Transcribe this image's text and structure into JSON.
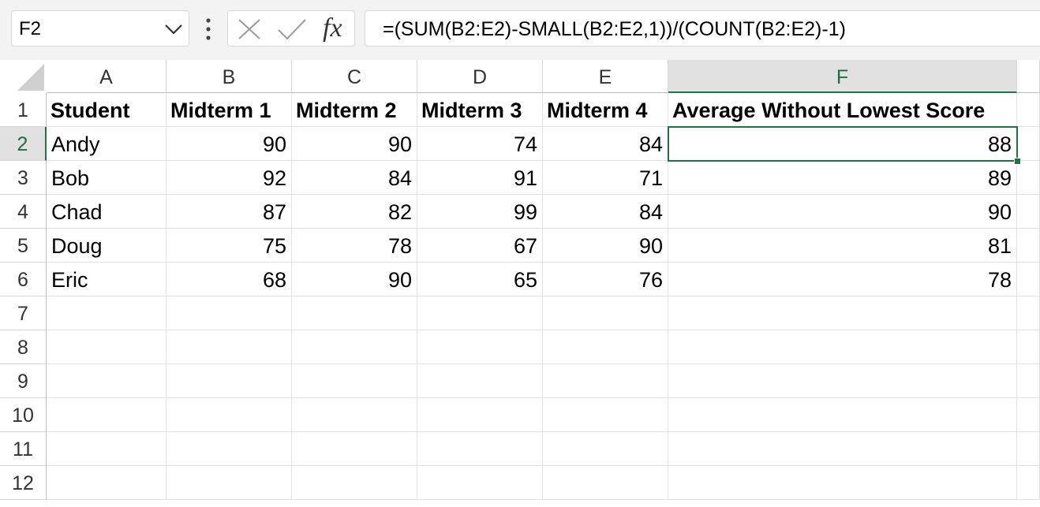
{
  "name_box": {
    "value": "F2"
  },
  "formula_bar": {
    "fx_label": "fx",
    "formula": "=(SUM(B2:E2)-SMALL(B2:E2,1))/(COUNT(B2:E2)-1)"
  },
  "icons": {
    "name_box_dropdown": "chevron-down-icon",
    "more": "vertical-dots-icon",
    "cancel": "x-icon",
    "enter": "checkmark-icon",
    "insert_function": "fx-icon"
  },
  "colors": {
    "selection_accent": "#217346",
    "header_selected_bg": "#e1e1e1"
  },
  "sheet": {
    "columns": [
      "A",
      "B",
      "C",
      "D",
      "E",
      "F"
    ],
    "rows": [
      "1",
      "2",
      "3",
      "4",
      "5",
      "6",
      "7",
      "8",
      "9",
      "10",
      "11",
      "12"
    ],
    "active_cell": "F2",
    "header_row": [
      "Student",
      "Midterm 1",
      "Midterm 2",
      "Midterm 3",
      "Midterm 4",
      "Average Without Lowest Score"
    ],
    "data": [
      [
        "Andy",
        "90",
        "90",
        "74",
        "84",
        "88"
      ],
      [
        "Bob",
        "92",
        "84",
        "91",
        "71",
        "89"
      ],
      [
        "Chad",
        "87",
        "82",
        "99",
        "84",
        "90"
      ],
      [
        "Doug",
        "75",
        "78",
        "67",
        "90",
        "81"
      ],
      [
        "Eric",
        "68",
        "90",
        "65",
        "76",
        "78"
      ]
    ]
  }
}
